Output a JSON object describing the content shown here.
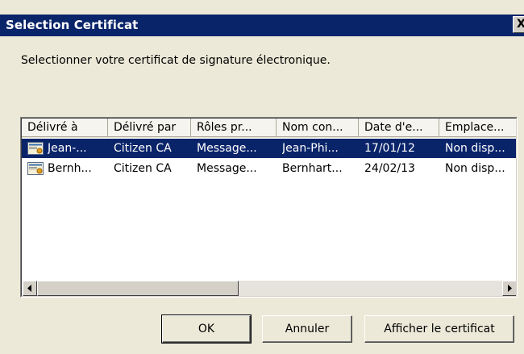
{
  "dialog": {
    "title": "Selection Certificat",
    "close_label": "X",
    "prompt": "Selectionner votre certificat de signature électronique."
  },
  "list": {
    "columns": [
      "Délivré à",
      "Délivré par",
      "Rôles pr...",
      "Nom con...",
      "Date d'e...",
      "Emplace..."
    ],
    "rows": [
      {
        "issued_to": "Jean-...",
        "issued_by": "Citizen CA",
        "roles": "Message...",
        "common_name": "Jean-Phi...",
        "date": "17/01/12",
        "location": "Non disp...",
        "selected": true
      },
      {
        "issued_to": "Bernh...",
        "issued_by": "Citizen CA",
        "roles": "Message...",
        "common_name": "Bernhart...",
        "date": "24/02/13",
        "location": "Non disp...",
        "selected": false
      }
    ]
  },
  "buttons": {
    "ok": "OK",
    "cancel": "Annuler",
    "view": "Afficher le certificat"
  },
  "icons": {
    "row_icon": "certificate-icon",
    "scroll_left": "scroll-left-arrow-icon",
    "scroll_right": "scroll-right-arrow-icon"
  },
  "colors": {
    "titlebar": "#0a246a",
    "selection": "#0a246a",
    "dialog_bg": "#ece9d8"
  }
}
